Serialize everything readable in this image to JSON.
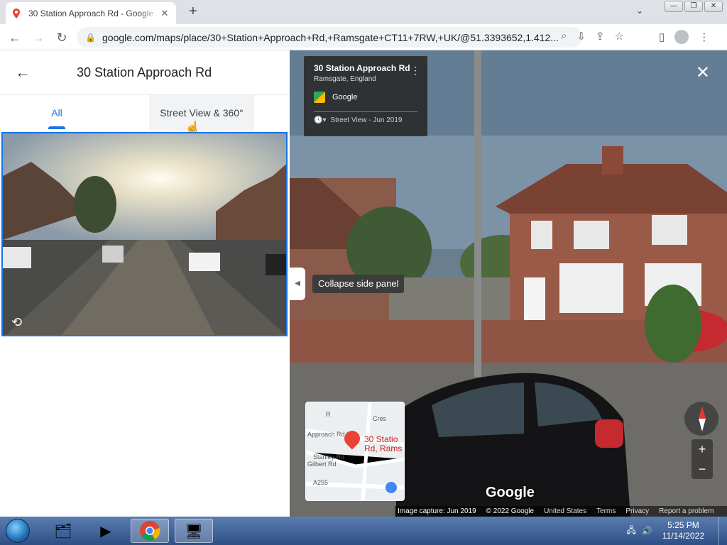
{
  "browser": {
    "tab_title": "30 Station Approach Rd - Google",
    "url": "google.com/maps/place/30+Station+Approach+Rd,+Ramsgate+CT11+7RW,+UK/@51.3393652,1.412..."
  },
  "panel": {
    "title": "30 Station Approach Rd",
    "tabs": [
      "All",
      "Street View & 360°"
    ]
  },
  "street_view": {
    "place_name": "30 Station Approach Rd",
    "place_sub": "Ramsgate, England",
    "source": "Google",
    "date": "Street View - Jun 2019",
    "tooltip": "Collapse side panel",
    "logo": "Google",
    "minimap_labels": [
      "Approach Rd",
      "Stanley Rd",
      "Gilbert Rd",
      "A255",
      "Cres",
      "R"
    ],
    "minimap_pin_label": "30 Statio Rd, Rams",
    "zoom_in": "+",
    "zoom_out": "−"
  },
  "footer": {
    "capture": "Image capture: Jun 2019",
    "copyright": "© 2022 Google",
    "region": "United States",
    "terms": "Terms",
    "privacy": "Privacy",
    "report": "Report a problem"
  },
  "taskbar": {
    "time": "5:25 PM",
    "date": "11/14/2022"
  }
}
